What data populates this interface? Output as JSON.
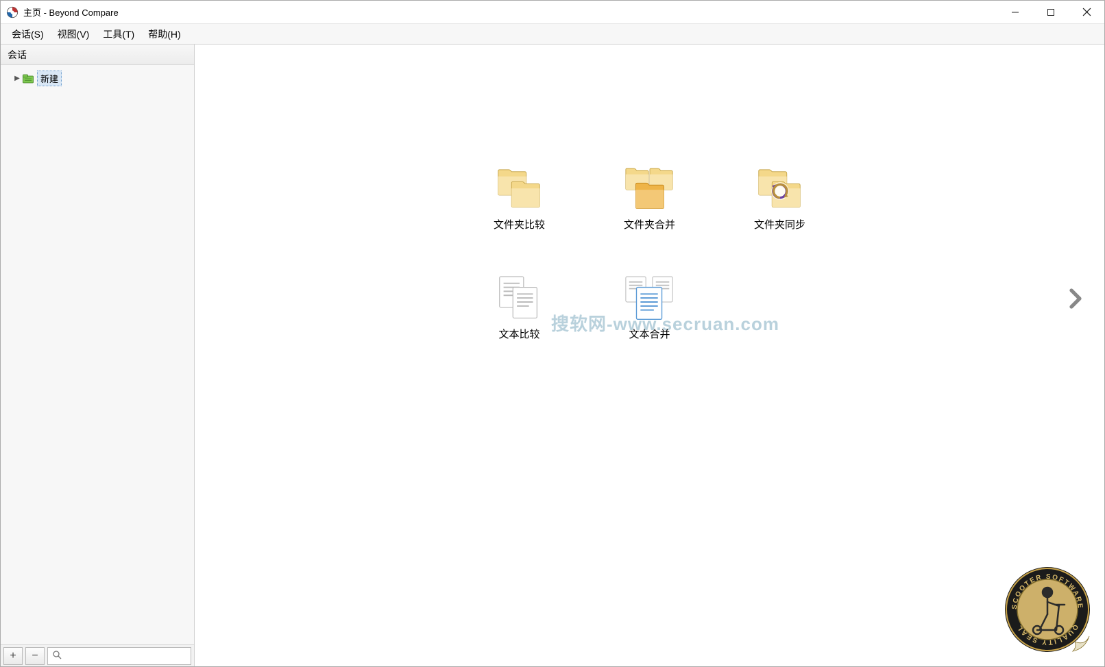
{
  "window": {
    "title": "主页 - Beyond Compare"
  },
  "menubar": {
    "items": [
      "会话(S)",
      "视图(V)",
      "工具(T)",
      "帮助(H)"
    ]
  },
  "sidebar": {
    "header": "会话",
    "tree": {
      "new_label": "新建"
    },
    "footer": {
      "add": "+",
      "remove": "−",
      "search_placeholder": ""
    }
  },
  "actions": {
    "folder_compare": "文件夹比较",
    "folder_merge": "文件夹合并",
    "folder_sync": "文件夹同步",
    "text_compare": "文本比较",
    "text_merge": "文本合并"
  },
  "watermark": "搜软网-www.secruan.com",
  "seal": {
    "outer_text_top": "SCOOTER SOFTWARE",
    "outer_text_bottom": "QUALITY SEAL"
  }
}
